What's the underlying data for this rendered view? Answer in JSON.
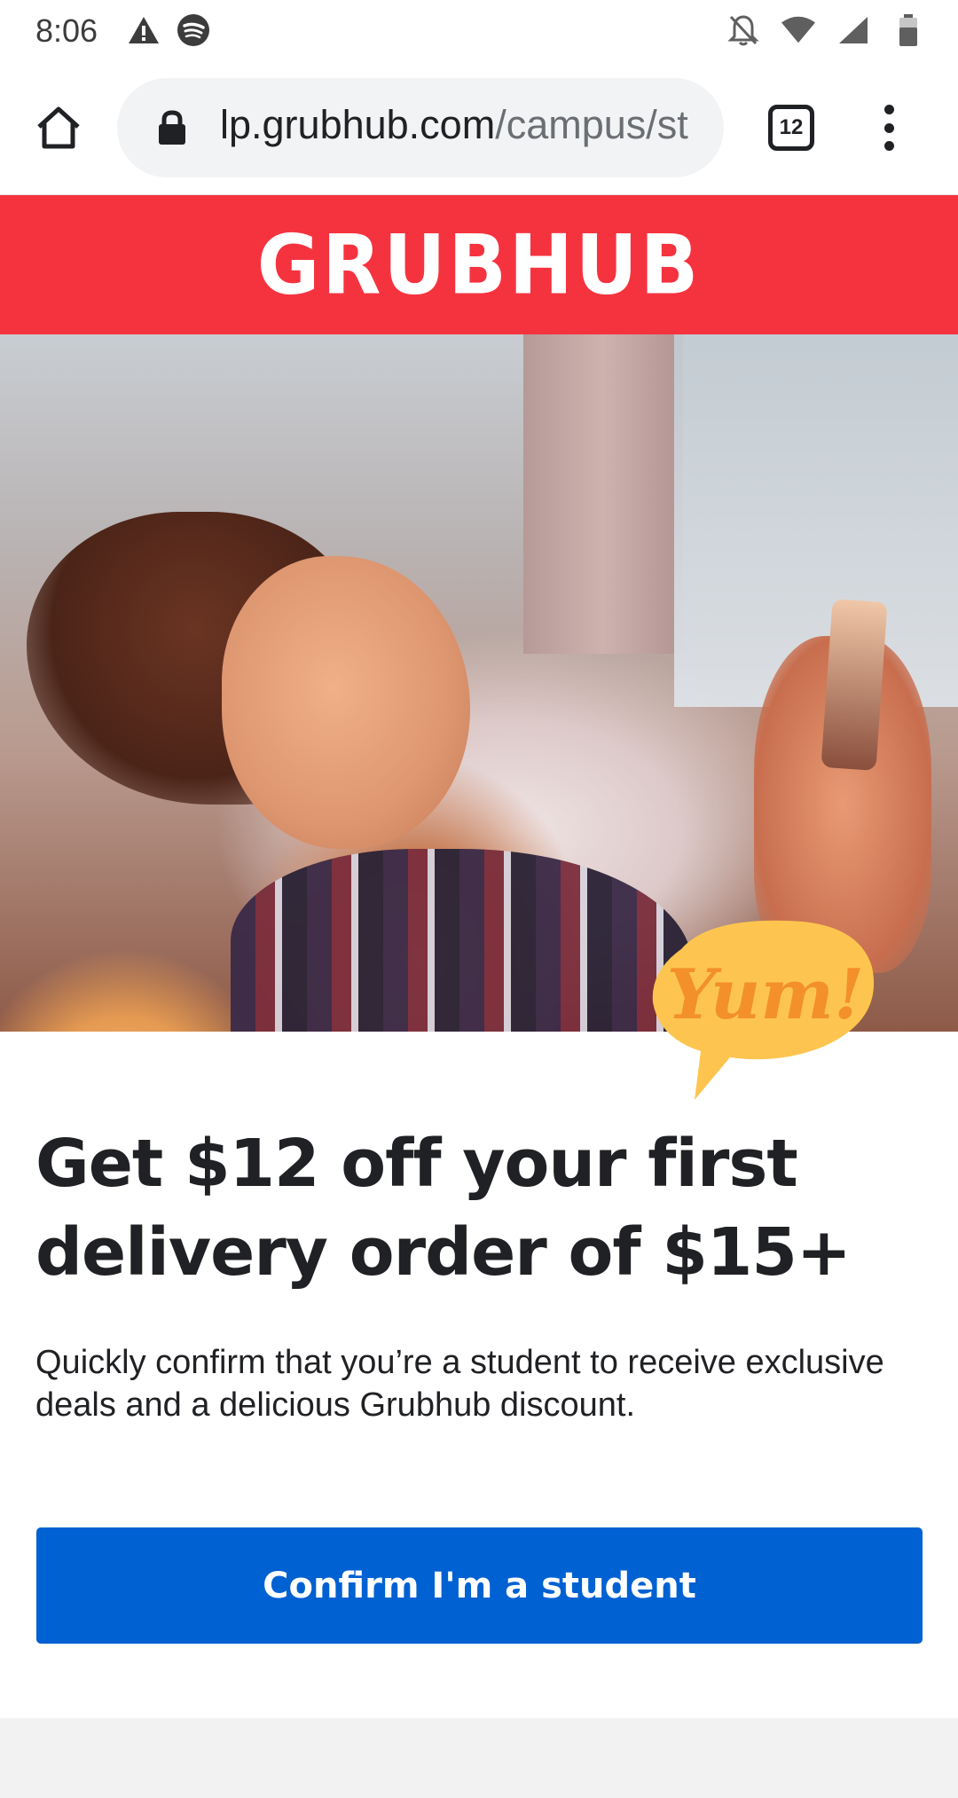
{
  "status_bar": {
    "time": "8:06",
    "left_icons": [
      "warning-icon",
      "spotify-icon"
    ],
    "right_icons": [
      "notifications-off-icon",
      "wifi-icon",
      "cell-signal-icon",
      "battery-icon"
    ]
  },
  "browser": {
    "url_host": "lp.grubhub.com",
    "url_path": "/campus/st",
    "tab_count": "12",
    "icons": [
      "home-icon",
      "lock-icon",
      "more-vert-icon"
    ]
  },
  "header": {
    "logo": "GRUBHUB",
    "background_color": "#f5333f"
  },
  "hero": {
    "badge_text": "Yum!"
  },
  "promo": {
    "headline": "Get $12 off your first delivery order of $15+",
    "description": "Quickly confirm that you’re a student to receive exclusive deals and a delicious Grubhub discount.",
    "cta_label": "Confirm I'm a student",
    "cta_color": "#0061d2"
  }
}
